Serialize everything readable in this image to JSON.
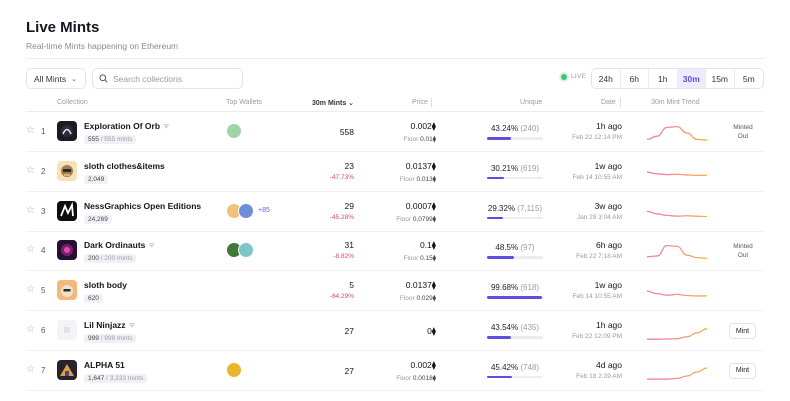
{
  "page": {
    "title": "Live Mints",
    "subtitle": "Real-time Mints happening on Ethereum"
  },
  "filters": {
    "dropdown": "All Mints",
    "search_placeholder": "Search collections",
    "live_label": "LIVE",
    "time_tabs": [
      "24h",
      "6h",
      "1h",
      "30m",
      "15m",
      "5m"
    ],
    "active_tab": "30m"
  },
  "columns": {
    "collection": "Collection",
    "top_wallets": "Top Wallets",
    "mints": "30m Mints ⌄",
    "price": "Price",
    "unique": "Unique",
    "date": "Date",
    "trend": "30m Mint Trend"
  },
  "colors": {
    "accent": "#5b4ee0",
    "negative": "#e0495e",
    "trend_gradient_start": "#e879c9",
    "trend_gradient_end": "#f5b042"
  },
  "rows": [
    {
      "rank": "1",
      "name": "Exploration Of Orb",
      "has_icon": true,
      "minted": "555",
      "supply": "555 mints",
      "wallets_more": "",
      "mints": "558",
      "change": "",
      "price": "0.002",
      "floor": "0.01",
      "unique_pct": "43.24%",
      "unique_count": "(240)",
      "unique_fraction": 0.43,
      "date_rel": "1h ago",
      "date_abs": "Feb 22 12:14 PM",
      "status": "Minted Out",
      "trend": [
        0.1,
        0.3,
        0.85,
        0.9,
        0.5,
        0.1,
        0.05
      ]
    },
    {
      "rank": "2",
      "name": "sloth clothes&items",
      "has_icon": false,
      "minted": "2,049",
      "supply": "",
      "wallets_more": "",
      "mints": "23",
      "change": "-47.73%",
      "price": "0.0137",
      "floor": "0.013",
      "unique_pct": "30.21%",
      "unique_count": "(619)",
      "unique_fraction": 0.3,
      "date_rel": "1w ago",
      "date_abs": "Feb 14 10:55 AM",
      "status": "",
      "trend": [
        0.55,
        0.45,
        0.4,
        0.42,
        0.38,
        0.35,
        0.36
      ]
    },
    {
      "rank": "3",
      "name": "NessGraphics Open Editions",
      "has_icon": false,
      "minted": "24,269",
      "supply": "",
      "wallets_more": "+85",
      "mints": "29",
      "change": "-45.28%",
      "price": "0.0007",
      "floor": "0.0799",
      "unique_pct": "29.32%",
      "unique_count": "(7,115)",
      "unique_fraction": 0.29,
      "date_rel": "3w ago",
      "date_abs": "Jan 29 3:04 AM",
      "status": "",
      "trend": [
        0.6,
        0.45,
        0.35,
        0.3,
        0.33,
        0.3,
        0.28
      ]
    },
    {
      "rank": "4",
      "name": "Dark Ordinauts",
      "has_icon": true,
      "minted": "200",
      "supply": "200 mints",
      "wallets_more": "",
      "mints": "31",
      "change": "-8.82%",
      "price": "0.1",
      "floor": "0.15",
      "unique_pct": "48.5%",
      "unique_count": "(97)",
      "unique_fraction": 0.485,
      "date_rel": "6h ago",
      "date_abs": "Feb 22 7:18 AM",
      "status": "Minted Out",
      "trend": [
        0.2,
        0.25,
        0.9,
        0.85,
        0.3,
        0.15,
        0.1
      ]
    },
    {
      "rank": "5",
      "name": "sloth body",
      "has_icon": false,
      "minted": "620",
      "supply": "",
      "wallets_more": "",
      "mints": "5",
      "change": "-64.29%",
      "price": "0.0137",
      "floor": "0.029",
      "unique_pct": "99.68%",
      "unique_count": "(618)",
      "unique_fraction": 0.99,
      "date_rel": "1w ago",
      "date_abs": "Feb 14 10:55 AM",
      "status": "",
      "trend": [
        0.55,
        0.4,
        0.3,
        0.35,
        0.28,
        0.25,
        0.26
      ]
    },
    {
      "rank": "6",
      "name": "Lil Ninjazz",
      "has_icon": true,
      "minted": "999",
      "supply": "999 mints",
      "wallets_more": "",
      "mints": "27",
      "change": "",
      "price": "0",
      "floor": "",
      "unique_pct": "43.54%",
      "unique_count": "(435)",
      "unique_fraction": 0.43,
      "date_rel": "1h ago",
      "date_abs": "Feb 22 12:09 PM",
      "status": "Mint",
      "trend": [
        0.05,
        0.05,
        0.06,
        0.08,
        0.2,
        0.45,
        0.7
      ]
    },
    {
      "rank": "7",
      "name": "ALPHA 51",
      "has_icon": false,
      "minted": "1,647",
      "supply": "3,333 mints",
      "wallets_more": "",
      "mints": "27",
      "change": "",
      "price": "0.002",
      "floor": "0.0018",
      "unique_pct": "45.42%",
      "unique_count": "(748)",
      "unique_fraction": 0.45,
      "date_rel": "4d ago",
      "date_abs": "Feb 18 2:39 AM",
      "status": "Mint",
      "trend": [
        0.05,
        0.06,
        0.05,
        0.1,
        0.25,
        0.5,
        0.75
      ]
    }
  ]
}
